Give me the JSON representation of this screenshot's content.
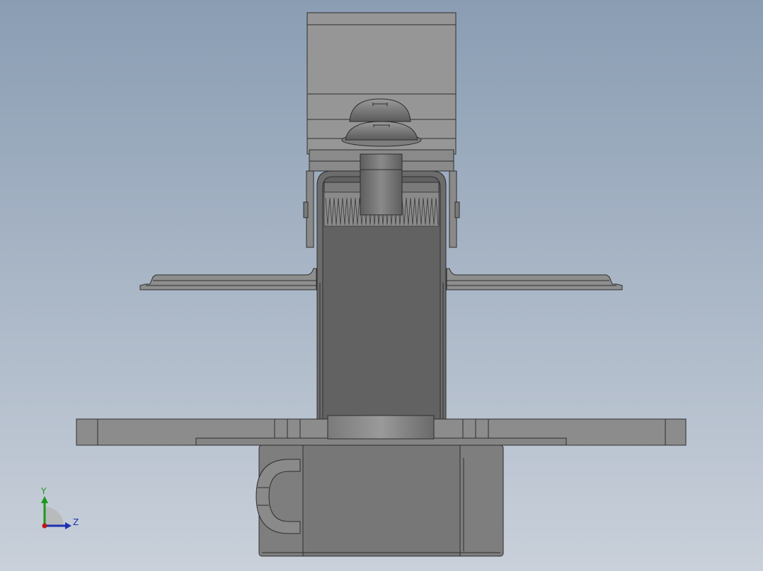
{
  "viewport": {
    "background_top": "#8a9db3",
    "background_bottom": "#c9d0da",
    "model_fill": "#8c8c8c",
    "model_dark": "#6a6a6a",
    "model_light": "#a8a8a8",
    "edge_color": "#2e2e2e"
  },
  "triad": {
    "y_label": "Y",
    "z_label": "Z",
    "y_color": "#1a9a1a",
    "z_color": "#1a2fb0",
    "origin_color": "#c01818"
  }
}
